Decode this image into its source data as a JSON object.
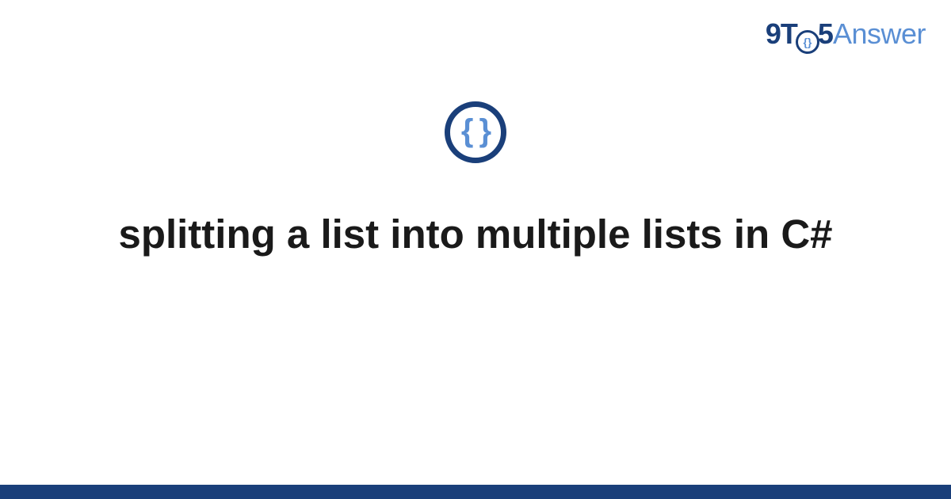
{
  "header": {
    "logo": {
      "part1": "9T",
      "inner_icon": "{}",
      "part2": "5",
      "part3": "Answer"
    }
  },
  "icon": {
    "symbol": "{ }"
  },
  "title": "splitting a list into multiple lists in C#",
  "colors": {
    "brand_dark": "#1a3f7a",
    "brand_light": "#5a8fd4"
  }
}
